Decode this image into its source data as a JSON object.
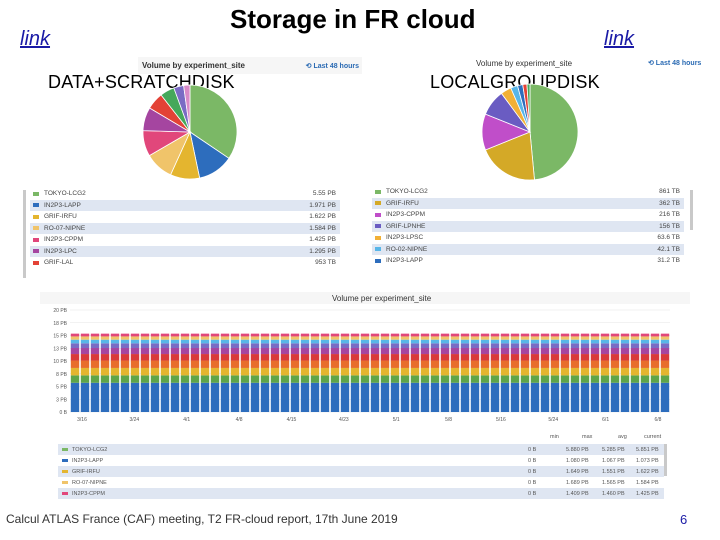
{
  "slide": {
    "title": "Storage in FR cloud",
    "link_left": "link",
    "link_right": "link",
    "left_label": "DATA+SCRATCHDISK",
    "right_label": "LOCALGROUPDISK",
    "footer": "Calcul ATLAS France (CAF) meeting, T2 FR-cloud report, 17th June 2019",
    "page_number": "6"
  },
  "left_panel": {
    "header": "Volume by experiment_site",
    "control": "⟲ Last 48 hours",
    "legend": [
      {
        "name": "TOKYO-LCG2",
        "value": "5.55 PB",
        "color": "#7bb866"
      },
      {
        "name": "IN2P3-LAPP",
        "value": "1.971 PB",
        "color": "#2d6dbd"
      },
      {
        "name": "GRIF-IRFU",
        "value": "1.622 PB",
        "color": "#e4b52f"
      },
      {
        "name": "RO-07-NIPNE",
        "value": "1.584 PB",
        "color": "#f0c46a"
      },
      {
        "name": "IN2P3-CPPM",
        "value": "1.425 PB",
        "color": "#e1477b"
      },
      {
        "name": "IN2P3-LPC",
        "value": "1.295 PB",
        "color": "#a545a0"
      },
      {
        "name": "GRIF-LAL",
        "value": "953 TB",
        "color": "#e34236"
      }
    ]
  },
  "right_panel": {
    "header": "Volume by experiment_site",
    "control": "⟲ Last 48 hours",
    "legend": [
      {
        "name": "TOKYO-LCG2",
        "value": "861 TB",
        "color": "#7bb866"
      },
      {
        "name": "GRIF-IRFU",
        "value": "362 TB",
        "color": "#d4a927"
      },
      {
        "name": "IN2P3-CPPM",
        "value": "216 TB",
        "color": "#c04ec9"
      },
      {
        "name": "GRIF-LPNHE",
        "value": "156 TB",
        "color": "#6a5cc2"
      },
      {
        "name": "IN2P3-LPSC",
        "value": "63.6 TB",
        "color": "#f2b036"
      },
      {
        "name": "RO-02-NIPNE",
        "value": "42.1 TB",
        "color": "#58b6e8"
      },
      {
        "name": "IN2P3-LAPP",
        "value": "31.2 TB",
        "color": "#2d6dbd"
      }
    ]
  },
  "bottom_panel": {
    "header": "Volume per experiment_site",
    "table_header": [
      "min",
      "max",
      "avg",
      "current"
    ],
    "table_rows": [
      {
        "name": "TOKYO-LCG2",
        "min": "0 B",
        "max": "5.880 PB",
        "avg": "5.285 PB",
        "current": "5.851 PB",
        "color": "#7bb866"
      },
      {
        "name": "IN2P3-LAPP",
        "min": "0 B",
        "max": "1.080 PB",
        "avg": "1.067 PB",
        "current": "1.073 PB",
        "color": "#2d6dbd"
      },
      {
        "name": "GRIF-IRFU",
        "min": "0 B",
        "max": "1.649 PB",
        "avg": "1.551 PB",
        "current": "1.622 PB",
        "color": "#e4b52f"
      },
      {
        "name": "RO-07-NIPNE",
        "min": "0 B",
        "max": "1.689 PB",
        "avg": "1.565 PB",
        "current": "1.584 PB",
        "color": "#f0c46a"
      },
      {
        "name": "IN2P3-CPPM",
        "min": "0 B",
        "max": "1.409 PB",
        "avg": "1.460 PB",
        "current": "1.425 PB",
        "color": "#e1477b"
      }
    ]
  },
  "chart_data": [
    {
      "type": "pie",
      "title": "Volume by experiment_site",
      "slices": [
        {
          "label": "TOKYO-LCG2",
          "value": 5.55,
          "color": "#7bb866"
        },
        {
          "label": "IN2P3-LAPP",
          "value": 1.971,
          "color": "#2d6dbd"
        },
        {
          "label": "GRIF-IRFU",
          "value": 1.622,
          "color": "#e4b52f"
        },
        {
          "label": "RO-07-NIPNE",
          "value": 1.584,
          "color": "#f0c46a"
        },
        {
          "label": "IN2P3-CPPM",
          "value": 1.425,
          "color": "#e1477b"
        },
        {
          "label": "IN2P3-LPC",
          "value": 1.295,
          "color": "#a545a0"
        },
        {
          "label": "GRIF-LAL",
          "value": 0.953,
          "color": "#e34236"
        },
        {
          "label": "",
          "value": 0.8,
          "color": "#45a85a"
        },
        {
          "label": "",
          "value": 0.55,
          "color": "#7a6bc4"
        },
        {
          "label": "",
          "value": 0.35,
          "color": "#d98ac8"
        }
      ]
    },
    {
      "type": "pie",
      "title": "Volume by experiment_site",
      "slices": [
        {
          "label": "TOKYO-LCG2",
          "value": 861,
          "color": "#7bb866"
        },
        {
          "label": "GRIF-IRFU",
          "value": 362,
          "color": "#d4a927"
        },
        {
          "label": "IN2P3-CPPM",
          "value": 216,
          "color": "#c04ec9"
        },
        {
          "label": "GRIF-LPNHE",
          "value": 156,
          "color": "#6a5cc2"
        },
        {
          "label": "IN2P3-LPSC",
          "value": 63.6,
          "color": "#f2b036"
        },
        {
          "label": "RO-02-NIPNE",
          "value": 42.1,
          "color": "#58b6e8"
        },
        {
          "label": "IN2P3-LAPP",
          "value": 31.2,
          "color": "#2d6dbd"
        },
        {
          "label": "",
          "value": 25,
          "color": "#e34236"
        },
        {
          "label": "",
          "value": 18,
          "color": "#45a85a"
        }
      ]
    },
    {
      "type": "bar",
      "title": "Volume per experiment_site",
      "categories": [
        "3/16",
        "3/24",
        "4/1",
        "4/8",
        "4/15",
        "4/23",
        "5/1",
        "5/8",
        "5/16",
        "5/24",
        "6/1",
        "6/8"
      ],
      "ylabel": "",
      "ylim": [
        0,
        22
      ],
      "yticks": [
        "20 PB",
        "18 PB",
        "15 PB",
        "13 PB",
        "10 PB",
        "8 PB",
        "5 PB",
        "3 PB",
        "0 B"
      ],
      "series": [
        {
          "name": "TOKYO-LCG2",
          "color": "#2d6dbd",
          "value": 6.3
        },
        {
          "name": "IN2P3-LAPP",
          "color": "#5fa548",
          "value": 1.6
        },
        {
          "name": "GRIF-IRFU",
          "color": "#e4b52f",
          "value": 1.6
        },
        {
          "name": "RO-07-NIPNE",
          "color": "#e86d2a",
          "value": 1.6
        },
        {
          "name": "IN2P3-CPPM",
          "color": "#d83a3a",
          "value": 1.4
        },
        {
          "name": "IN2P3-LPC",
          "color": "#a545a0",
          "value": 1.3
        },
        {
          "name": "GRIF-LAL",
          "color": "#7a6bc4",
          "value": 1.0
        },
        {
          "name": "",
          "color": "#58b6e8",
          "value": 0.8
        },
        {
          "name": "",
          "color": "#f0c46a",
          "value": 0.7
        },
        {
          "name": "",
          "color": "#e1477b",
          "value": 0.6
        }
      ],
      "bar_count": 60
    }
  ]
}
